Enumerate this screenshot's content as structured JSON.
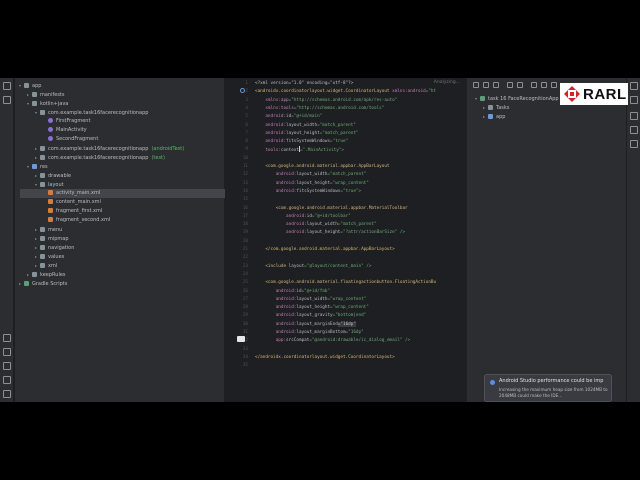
{
  "project_tree": [
    {
      "label": "app",
      "indent": 0,
      "chev": "▾",
      "icon": "folder",
      "icon_name": "folder-icon"
    },
    {
      "label": "manifests",
      "indent": 1,
      "chev": "▸",
      "icon": "folder",
      "icon_name": "folder-icon"
    },
    {
      "label": "kotlin+java",
      "indent": 1,
      "chev": "▾",
      "icon": "folder",
      "icon_name": "folder-icon"
    },
    {
      "label": "com.example.task16facerecognitionapp",
      "indent": 2,
      "chev": "▾",
      "icon": "folder",
      "icon_name": "package-icon"
    },
    {
      "label": "FirstFragment",
      "indent": 3,
      "chev": "",
      "icon": "kt",
      "icon_name": "kotlin-class-icon"
    },
    {
      "label": "MainActivity",
      "indent": 3,
      "chev": "",
      "icon": "kt",
      "icon_name": "kotlin-class-icon"
    },
    {
      "label": "SecondFragment",
      "indent": 3,
      "chev": "",
      "icon": "kt",
      "icon_name": "kotlin-class-icon"
    },
    {
      "label": "com.example.task16facerecognitionapp",
      "suffix": "(androidTest)",
      "suffix_class": "green",
      "indent": 2,
      "chev": "▸",
      "icon": "folder",
      "icon_name": "package-icon"
    },
    {
      "label": "com.example.task16facerecognitionapp",
      "suffix": "(test)",
      "suffix_class": "green",
      "indent": 2,
      "chev": "▸",
      "icon": "folder",
      "icon_name": "package-icon"
    },
    {
      "label": "res",
      "indent": 1,
      "chev": "▾",
      "icon": "res",
      "icon_name": "resource-folder-icon"
    },
    {
      "label": "drawable",
      "indent": 2,
      "chev": "▸",
      "icon": "folder",
      "icon_name": "folder-icon"
    },
    {
      "label": "layout",
      "indent": 2,
      "chev": "▾",
      "icon": "folder",
      "icon_name": "folder-icon"
    },
    {
      "label": "activity_main.xml",
      "indent": 3,
      "chev": "",
      "icon": "xml",
      "icon_name": "xml-file-icon",
      "selected": true
    },
    {
      "label": "content_main.xml",
      "indent": 3,
      "chev": "",
      "icon": "xml",
      "icon_name": "xml-file-icon"
    },
    {
      "label": "fragment_first.xml",
      "indent": 3,
      "chev": "",
      "icon": "xml",
      "icon_name": "xml-file-icon"
    },
    {
      "label": "fragment_second.xml",
      "indent": 3,
      "chev": "",
      "icon": "xml",
      "icon_name": "xml-file-icon"
    },
    {
      "label": "menu",
      "indent": 2,
      "chev": "▸",
      "icon": "folder",
      "icon_name": "folder-icon"
    },
    {
      "label": "mipmap",
      "indent": 2,
      "chev": "▸",
      "icon": "folder",
      "icon_name": "folder-icon"
    },
    {
      "label": "navigation",
      "indent": 2,
      "chev": "▸",
      "icon": "folder",
      "icon_name": "folder-icon"
    },
    {
      "label": "values",
      "indent": 2,
      "chev": "▸",
      "icon": "folder",
      "icon_name": "folder-icon"
    },
    {
      "label": "xml",
      "indent": 2,
      "chev": "▸",
      "icon": "folder",
      "icon_name": "folder-icon"
    },
    {
      "label": "keepRules",
      "indent": 1,
      "chev": "▸",
      "icon": "folder",
      "icon_name": "folder-icon"
    },
    {
      "label": "Gradle Scripts",
      "indent": 0,
      "chev": "▸",
      "icon": "grad",
      "icon_name": "gradle-icon"
    }
  ],
  "editor": {
    "status": "Analyzing...",
    "lines": [
      [
        {
          "t": "<?xml version=\"1.0\" encoding=\"utf-8\"?>",
          "c": "prolog"
        }
      ],
      [
        {
          "t": "<androidx.coordinatorlayout.widget.CoordinatorLayout ",
          "c": "tag"
        },
        {
          "t": "xmlns:",
          "c": "ns"
        },
        {
          "t": "android",
          "c": "ns"
        },
        {
          "t": "=\"ht",
          "c": "val"
        }
      ],
      [
        {
          "t": "    xmlns:",
          "c": "ns"
        },
        {
          "t": "app",
          "c": "ns"
        },
        {
          "t": "=\"http://schemas.android.com/apk/res-auto\"",
          "c": "val"
        }
      ],
      [
        {
          "t": "    xmlns:",
          "c": "ns"
        },
        {
          "t": "tools",
          "c": "ns"
        },
        {
          "t": "=\"http://schemas.android.com/tools\"",
          "c": "val"
        }
      ],
      [
        {
          "t": "    android:",
          "c": "ns"
        },
        {
          "t": "id",
          "c": "attr"
        },
        {
          "t": "=\"@+id/main\"",
          "c": "val"
        }
      ],
      [
        {
          "t": "    android:",
          "c": "ns"
        },
        {
          "t": "layout_width",
          "c": "attr"
        },
        {
          "t": "=\"match_parent\"",
          "c": "val"
        }
      ],
      [
        {
          "t": "    android:",
          "c": "ns"
        },
        {
          "t": "layout_height",
          "c": "attr"
        },
        {
          "t": "=\"match_parent\"",
          "c": "val"
        }
      ],
      [
        {
          "t": "    android:",
          "c": "ns"
        },
        {
          "t": "fitsSystemWindows",
          "c": "attr"
        },
        {
          "t": "=\"true\"",
          "c": "val"
        }
      ],
      [
        {
          "t": "    tools:",
          "c": "ns"
        },
        {
          "t": "context",
          "c": "attr"
        },
        {
          "t": "=\".MainActivity\">",
          "c": "val"
        }
      ],
      [
        {
          "t": "",
          "c": "prolog"
        }
      ],
      [
        {
          "t": "    <com.google.android.material.appbar.AppBarLayout",
          "c": "tag"
        }
      ],
      [
        {
          "t": "        android:",
          "c": "ns"
        },
        {
          "t": "layout_width",
          "c": "attr"
        },
        {
          "t": "=\"match_parent\"",
          "c": "val"
        }
      ],
      [
        {
          "t": "        android:",
          "c": "ns"
        },
        {
          "t": "layout_height",
          "c": "attr"
        },
        {
          "t": "=\"wrap_content\"",
          "c": "val"
        }
      ],
      [
        {
          "t": "        android:",
          "c": "ns"
        },
        {
          "t": "fitsSystemWindows",
          "c": "attr"
        },
        {
          "t": "=\"true\">",
          "c": "val"
        }
      ],
      [
        {
          "t": "",
          "c": "prolog"
        }
      ],
      [
        {
          "t": "        <com.google.android.material.appbar.MaterialToolbar",
          "c": "tag"
        }
      ],
      [
        {
          "t": "            android:",
          "c": "ns"
        },
        {
          "t": "id",
          "c": "attr"
        },
        {
          "t": "=\"@+id/toolbar\"",
          "c": "val"
        }
      ],
      [
        {
          "t": "            android:",
          "c": "ns"
        },
        {
          "t": "layout_width",
          "c": "attr"
        },
        {
          "t": "=\"match_parent\"",
          "c": "val"
        }
      ],
      [
        {
          "t": "            android:",
          "c": "ns"
        },
        {
          "t": "layout_height",
          "c": "attr"
        },
        {
          "t": "=\"?attr/actionBarSize\" />",
          "c": "val"
        }
      ],
      [
        {
          "t": "",
          "c": "prolog"
        }
      ],
      [
        {
          "t": "    </com.google.android.material.appbar.AppBarLayout>",
          "c": "tag"
        }
      ],
      [
        {
          "t": "",
          "c": "prolog"
        }
      ],
      [
        {
          "t": "    <include ",
          "c": "tag"
        },
        {
          "t": "layout",
          "c": "attr"
        },
        {
          "t": "=\"@layout/content_main\" />",
          "c": "val"
        }
      ],
      [
        {
          "t": "",
          "c": "prolog"
        }
      ],
      [
        {
          "t": "    <com.google.android.material.floatingactionbutton.FloatingActionBu",
          "c": "tag"
        }
      ],
      [
        {
          "t": "        android:",
          "c": "ns"
        },
        {
          "t": "id",
          "c": "attr"
        },
        {
          "t": "=\"@+id/fab\"",
          "c": "val"
        }
      ],
      [
        {
          "t": "        android:",
          "c": "ns"
        },
        {
          "t": "layout_width",
          "c": "attr"
        },
        {
          "t": "=\"wrap_content\"",
          "c": "val"
        }
      ],
      [
        {
          "t": "        android:",
          "c": "ns"
        },
        {
          "t": "layout_height",
          "c": "attr"
        },
        {
          "t": "=\"wrap_content\"",
          "c": "val"
        }
      ],
      [
        {
          "t": "        android:",
          "c": "ns"
        },
        {
          "t": "layout_gravity",
          "c": "attr"
        },
        {
          "t": "=\"bottom|end\"",
          "c": "val"
        }
      ],
      [
        {
          "t": "        android:",
          "c": "ns"
        },
        {
          "t": "layout_marginEnd",
          "c": "attr"
        },
        {
          "t": "=\"16dp\"",
          "c": "val"
        }
      ],
      [
        {
          "t": "        android:",
          "c": "ns"
        },
        {
          "t": "layout_marginBottom",
          "c": "attr"
        },
        {
          "t": "=\"16dp\"",
          "c": "val"
        }
      ],
      [
        {
          "t": "        app:",
          "c": "ns"
        },
        {
          "t": "srcCompat",
          "c": "attr"
        },
        {
          "t": "=\"@android:drawable/ic_dialog_email\" />",
          "c": "val"
        }
      ],
      [
        {
          "t": "",
          "c": "prolog"
        }
      ],
      [
        {
          "t": "</androidx.coordinatorlayout.widget.CoordinatorLayout>",
          "c": "tag"
        }
      ],
      [
        {
          "t": "",
          "c": "prolog"
        }
      ]
    ]
  },
  "gradle_panel": {
    "title": "Gr",
    "items": [
      {
        "label": "task 16 FaceRecognitionApp",
        "chev": "▾",
        "icon_name": "gradle-project-icon"
      },
      {
        "label": "Tasks",
        "chev": "▸",
        "icon_name": "folder-icon"
      },
      {
        "label": "app",
        "chev": "▸",
        "icon_name": "module-icon"
      }
    ]
  },
  "logo": {
    "text": "RARL"
  },
  "notification": {
    "title": "Android Studio performance could be imp",
    "body": "Increasing the maximum heap size from 1024MB to 2048MB could make the IDE..."
  }
}
